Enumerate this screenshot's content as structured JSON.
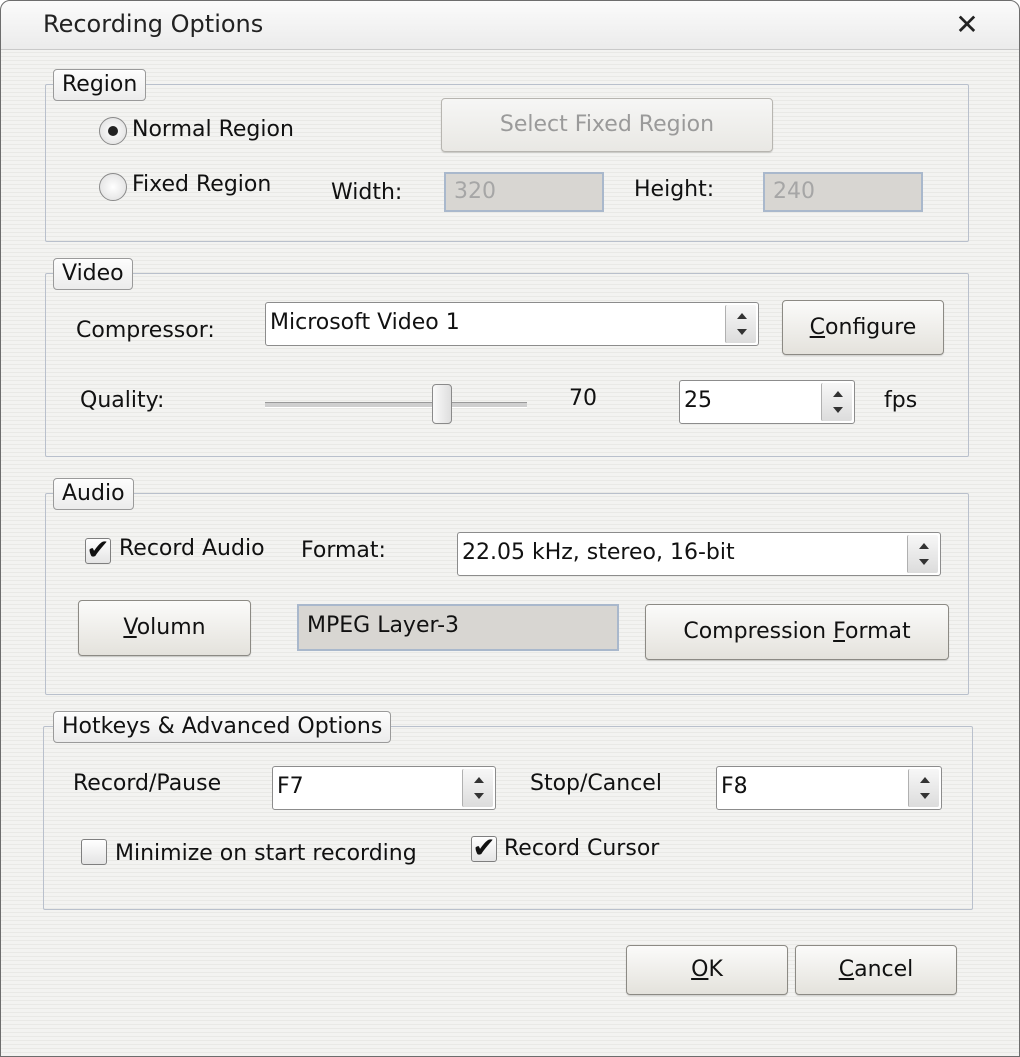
{
  "dialog": {
    "title": "Recording Options",
    "close_glyph": "✕"
  },
  "region": {
    "legend": "Region",
    "normal_label": "Normal Region",
    "fixed_label": "Fixed Region",
    "select_button": "Select Fixed Region",
    "width_label": "Width:",
    "width_value": "320",
    "height_label": "Height:",
    "height_value": "240",
    "selected": "normal"
  },
  "video": {
    "legend": "Video",
    "compressor_label": "Compressor:",
    "compressor_value": "Microsoft Video 1",
    "configure_button": "onfigure",
    "configure_mnemonic": "C",
    "quality_label": "Quality:",
    "quality_value": "70",
    "quality_fraction": 0.7,
    "fps_value": "25",
    "fps_label": "fps"
  },
  "audio": {
    "legend": "Audio",
    "record_audio_label": "Record Audio",
    "record_audio_checked": true,
    "format_label": "Format:",
    "format_value": "22.05 kHz, stereo, 16-bit",
    "volumn_button_mnemonic": "V",
    "volumn_button_rest": "olumn",
    "codec_value": "MPEG Layer-3",
    "compression_button_pre": "Compression ",
    "compression_button_mnemonic": "F",
    "compression_button_post": "ormat"
  },
  "hotkeys": {
    "legend": "Hotkeys & Advanced Options",
    "record_pause_label": "Record/Pause",
    "record_pause_value": "F7",
    "stop_cancel_label": "Stop/Cancel",
    "stop_cancel_value": "F8",
    "minimize_label": "Minimize on start recording",
    "minimize_checked": false,
    "record_cursor_label": "Record Cursor",
    "record_cursor_checked": true
  },
  "footer": {
    "ok_mnemonic": "O",
    "ok_rest": "K",
    "cancel_mnemonic": "C",
    "cancel_rest": "ancel"
  },
  "check_glyph": "✔"
}
